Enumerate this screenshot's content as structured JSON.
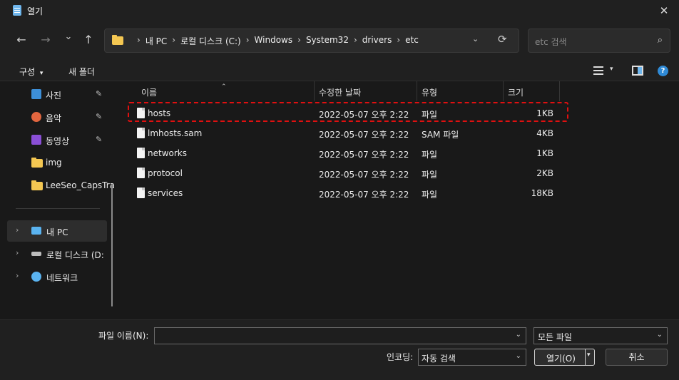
{
  "window": {
    "title": "열기",
    "close_symbol": "✕"
  },
  "nav": {
    "back": "←",
    "forward": "→",
    "recent": "⌄",
    "up": "↑",
    "breadcrumbs": [
      "내 PC",
      "로컬 디스크 (C:)",
      "Windows",
      "System32",
      "drivers",
      "etc"
    ],
    "refresh": "⟳",
    "search_placeholder": "etc 검색",
    "search_icon": "⌕"
  },
  "toolbar": {
    "organize": "구성",
    "organize_chev": "▾",
    "new_folder": "새 폴더",
    "help": "?"
  },
  "sidebar": {
    "quick": [
      {
        "label": "사진",
        "icon": "photos-icon",
        "color": "#3d8fd8",
        "pinned": true
      },
      {
        "label": "음악",
        "icon": "music-icon",
        "color": "#e2663f",
        "pinned": true
      },
      {
        "label": "동영상",
        "icon": "video-icon",
        "color": "#8a4fd6",
        "pinned": true
      },
      {
        "label": "img",
        "icon": "folder-icon",
        "color": "#f4c752",
        "pinned": false
      },
      {
        "label": "LeeSeo_CapsTra",
        "icon": "folder-icon",
        "color": "#f4c752",
        "pinned": false
      }
    ],
    "tree": [
      {
        "label": "내 PC",
        "icon": "pc-icon",
        "selected": true
      },
      {
        "label": "로컬 디스크 (D:",
        "icon": "drive-icon",
        "selected": false
      },
      {
        "label": "네트워크",
        "icon": "network-icon",
        "selected": false
      }
    ],
    "pin_symbol": "📌",
    "expand_symbol": "›"
  },
  "columns": {
    "name": "이름",
    "date": "수정한 날짜",
    "type": "유형",
    "size": "크기"
  },
  "files": [
    {
      "name": "hosts",
      "date": "2022-05-07 오후 2:22",
      "type": "파일",
      "size": "1KB",
      "highlighted": true
    },
    {
      "name": "lmhosts.sam",
      "date": "2022-05-07 오후 2:22",
      "type": "SAM 파일",
      "size": "4KB",
      "highlighted": false
    },
    {
      "name": "networks",
      "date": "2022-05-07 오후 2:22",
      "type": "파일",
      "size": "1KB",
      "highlighted": false
    },
    {
      "name": "protocol",
      "date": "2022-05-07 오후 2:22",
      "type": "파일",
      "size": "2KB",
      "highlighted": false
    },
    {
      "name": "services",
      "date": "2022-05-07 오후 2:22",
      "type": "파일",
      "size": "18KB",
      "highlighted": false
    }
  ],
  "bottom": {
    "filename_label": "파일 이름(N):",
    "filename_value": "",
    "filetype_value": "모든 파일",
    "encoding_label": "인코딩:",
    "encoding_value": "자동 검색",
    "open_label": "열기(O)",
    "cancel_label": "취소",
    "chev": "⌄"
  },
  "colors": {
    "highlight": "#e01010",
    "accent": "#2f8ad6"
  }
}
